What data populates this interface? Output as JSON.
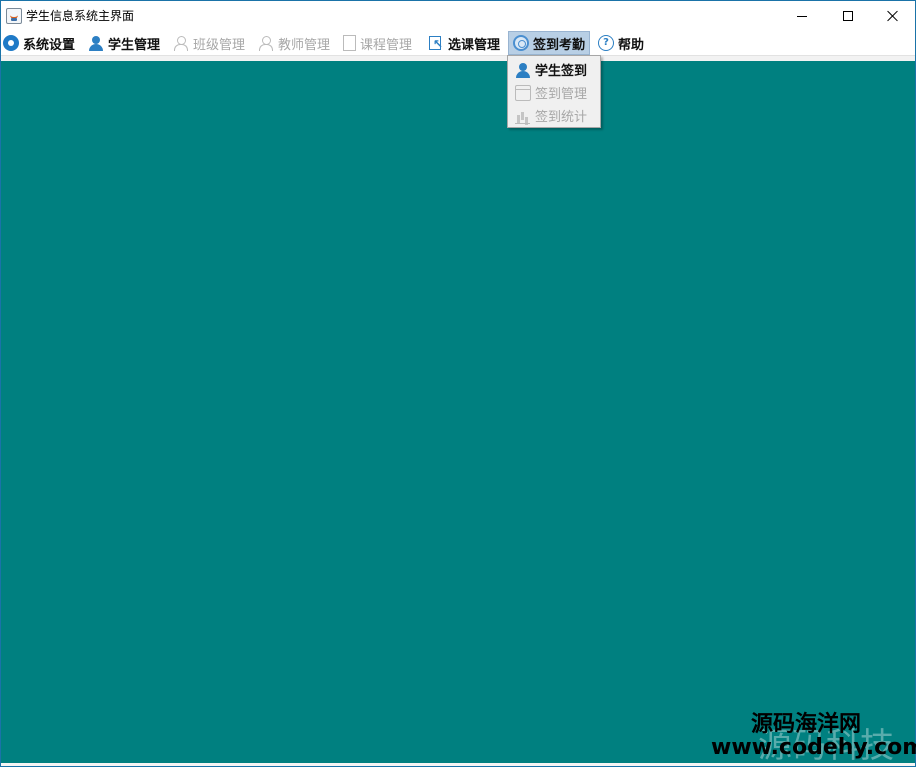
{
  "window": {
    "title": "学生信息系统主界面",
    "icon": "java-app-icon"
  },
  "titlebar_controls": {
    "minimize": "minimize-icon",
    "maximize": "maximize-icon",
    "close": "close-icon"
  },
  "menubar": {
    "items": [
      {
        "label": "系统设置",
        "icon": "gear-icon",
        "enabled": true
      },
      {
        "label": "学生管理",
        "icon": "student-icon",
        "enabled": true
      },
      {
        "label": "班级管理",
        "icon": "class-icon",
        "enabled": false
      },
      {
        "label": "教师管理",
        "icon": "teacher-icon",
        "enabled": false
      },
      {
        "label": "课程管理",
        "icon": "course-icon",
        "enabled": false
      },
      {
        "label": "选课管理",
        "icon": "select-course-icon",
        "enabled": true
      },
      {
        "label": "签到考勤",
        "icon": "attendance-icon",
        "enabled": true,
        "active": true
      },
      {
        "label": "帮助",
        "icon": "help-icon",
        "enabled": true
      }
    ]
  },
  "attendance_menu": {
    "items": [
      {
        "label": "学生签到",
        "icon": "student-icon",
        "enabled": true
      },
      {
        "label": "签到管理",
        "icon": "calendar-icon",
        "enabled": false
      },
      {
        "label": "签到统计",
        "icon": "bar-chart-icon",
        "enabled": false
      }
    ]
  },
  "desktop": {
    "background": "#008080"
  },
  "watermark": {
    "line1": "源码海洋网",
    "line2": "www.codehy.com",
    "ghost": "源码科技"
  }
}
